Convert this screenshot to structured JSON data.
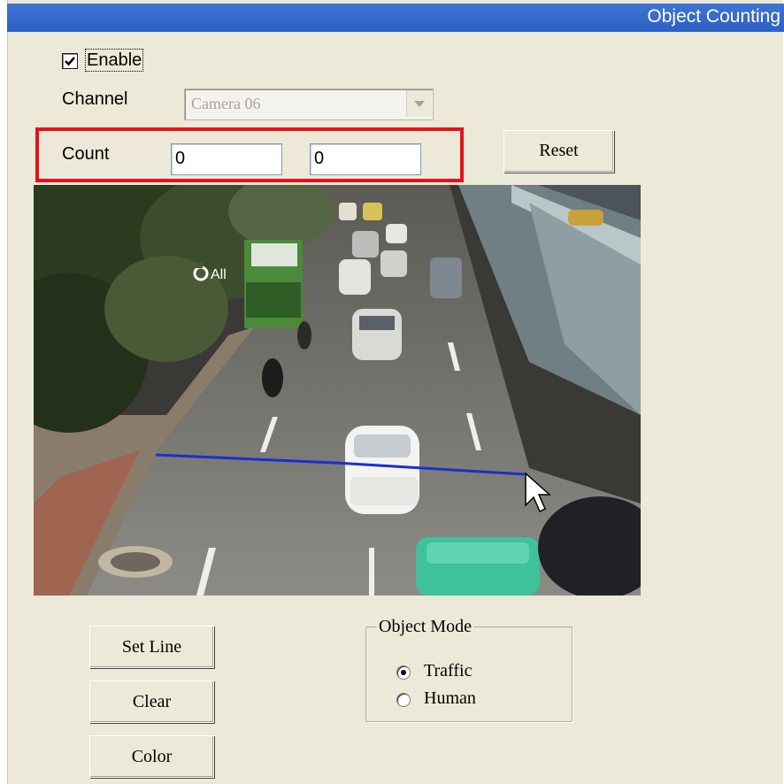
{
  "window": {
    "title": "Object Counting"
  },
  "enable": {
    "label": "Enable",
    "checked": true
  },
  "channel": {
    "label": "Channel",
    "value": "Camera 06"
  },
  "count": {
    "label": "Count",
    "value_a": "0",
    "value_b": "0"
  },
  "buttons": {
    "reset": "Reset",
    "set_line": "Set Line",
    "clear": "Clear",
    "color": "Color"
  },
  "video": {
    "overlay_text": "All"
  },
  "object_mode": {
    "legend": "Object Mode",
    "options": [
      {
        "label": "Traffic",
        "selected": true
      },
      {
        "label": "Human",
        "selected": false
      }
    ]
  },
  "colors": {
    "highlight": "#e8101c",
    "counting_line": "#1a2fd0",
    "title_bar": "#3a6fd4"
  }
}
